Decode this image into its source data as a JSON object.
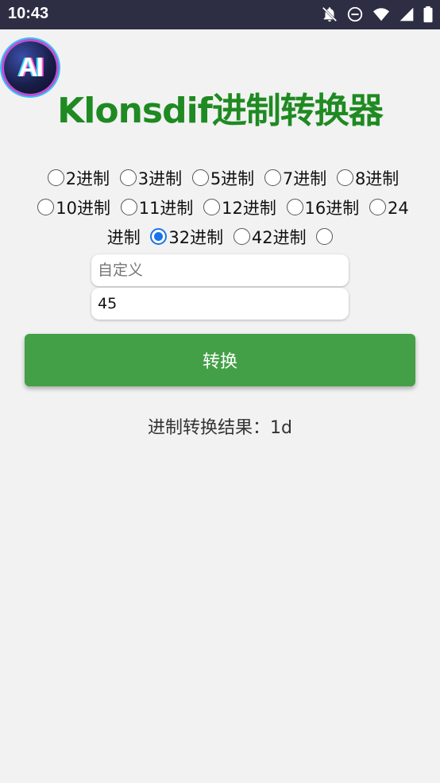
{
  "status_bar": {
    "time": "10:43",
    "icons": [
      "notifications-off-icon",
      "do-not-disturb-icon",
      "wifi-icon",
      "signal-icon",
      "battery-icon"
    ]
  },
  "logo": {
    "text": "AI"
  },
  "title": "Klonsdif进制转换器",
  "radix_options": [
    {
      "label": "2进制",
      "checked": false
    },
    {
      "label": "3进制",
      "checked": false
    },
    {
      "label": "5进制",
      "checked": false
    },
    {
      "label": "7进制",
      "checked": false
    },
    {
      "label": "8进制",
      "checked": false
    },
    {
      "label": "10进制",
      "checked": false
    },
    {
      "label": "11进制",
      "checked": false
    },
    {
      "label": "12进制",
      "checked": false
    },
    {
      "label": "16进制",
      "checked": false
    },
    {
      "label": "24进制",
      "checked": false
    },
    {
      "label": "32进制",
      "checked": true
    },
    {
      "label": "42进制",
      "checked": false
    },
    {
      "label": "",
      "checked": false
    }
  ],
  "custom_input": {
    "placeholder": "自定义",
    "value": ""
  },
  "number_input": {
    "value": "45"
  },
  "convert_button": {
    "label": "转换"
  },
  "result": {
    "text": "进制转换结果：1d"
  },
  "colors": {
    "title": "#1f8a22",
    "button": "#43a047",
    "radio_checked": "#1a73e8",
    "status_bar": "#2d2d44"
  }
}
